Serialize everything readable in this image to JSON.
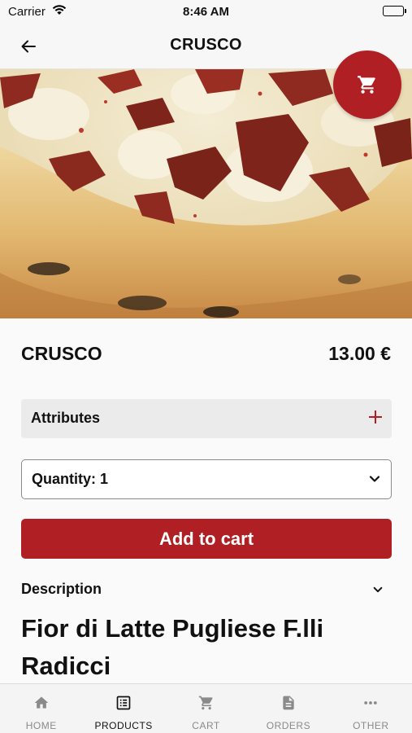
{
  "status": {
    "carrier": "Carrier",
    "time": "8:46 AM"
  },
  "nav": {
    "title": "CRUSCO"
  },
  "product": {
    "name": "CRUSCO",
    "price": "13.00 €"
  },
  "attributes": {
    "label": "Attributes"
  },
  "quantity": {
    "label": "Quantity: 1",
    "value": 1
  },
  "actions": {
    "add_to_cart": "Add to cart"
  },
  "description": {
    "label": "Description",
    "text": "Fior di Latte Pugliese F.lli Radicci"
  },
  "tabs": [
    {
      "label": "HOME",
      "icon": "home-icon",
      "active": false
    },
    {
      "label": "PRODUCTS",
      "icon": "list-icon",
      "active": true
    },
    {
      "label": "CART",
      "icon": "cart-icon",
      "active": false
    },
    {
      "label": "ORDERS",
      "icon": "document-icon",
      "active": false
    },
    {
      "label": "OTHER",
      "icon": "more-icon",
      "active": false
    }
  ],
  "colors": {
    "accent": "#b01f24",
    "tab_inactive": "#8a8a8a",
    "tab_active": "#111111"
  }
}
